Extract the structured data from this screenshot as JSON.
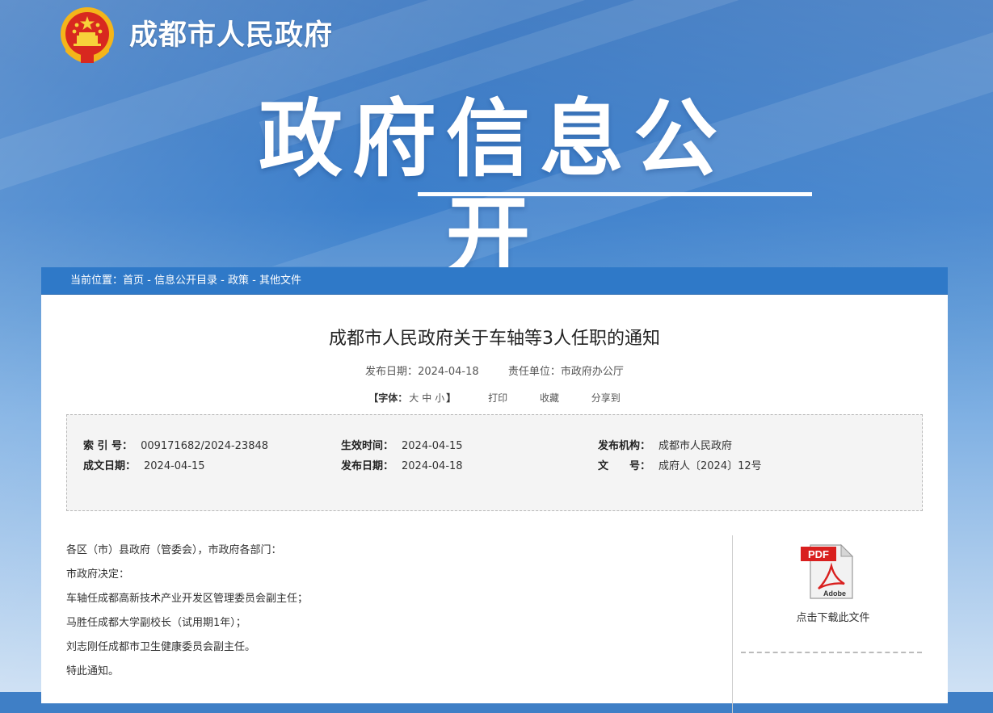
{
  "header": {
    "site_name": "成都市人民政府",
    "banner_title": "政府信息公开"
  },
  "breadcrumb": {
    "prefix": "当前位置：",
    "items": [
      "首页",
      "信息公开目录",
      "政策",
      "其他文件"
    ],
    "separator": " - "
  },
  "article": {
    "title": "成都市人民政府关于车轴等3人任职的通知",
    "publish_date_label": "发布日期：",
    "publish_date": "2024-04-18",
    "unit_label": "责任单位：",
    "unit": "市政府办公厅"
  },
  "tools": {
    "font_label": "字体：",
    "open_bracket": "【",
    "close_bracket": "】",
    "sizes": [
      "大",
      "中",
      "小"
    ],
    "print": "打印",
    "favorite": "收藏",
    "share": "分享到"
  },
  "info": {
    "index_label": "索 引 号：",
    "index_value": "009171682/2024-23848",
    "effective_label": "生效时间：",
    "effective_value": "2024-04-15",
    "issuer_label": "发布机构：",
    "issuer_value": "成都市人民政府",
    "written_label": "成文日期：",
    "written_value": "2024-04-15",
    "pub_label": "发布日期：",
    "pub_value": "2024-04-18",
    "docno_label": "文　　号：",
    "docno_value": "成府人〔2024〕12号"
  },
  "body": {
    "paragraphs": [
      "各区（市）县政府（管委会），市政府各部门：",
      "市政府决定：",
      "车轴任成都高新技术产业开发区管理委员会副主任；",
      "马胜任成都大学副校长（试用期1年）；",
      "刘志刚任成都市卫生健康委员会副主任。",
      "特此通知。"
    ]
  },
  "download": {
    "icon_text_top": "PDF",
    "icon_text_bottom": "Adobe",
    "label": "点击下载此文件"
  },
  "colors": {
    "breadcrumb_bg": "#2f79c8",
    "pdf_red": "#d9201f"
  }
}
